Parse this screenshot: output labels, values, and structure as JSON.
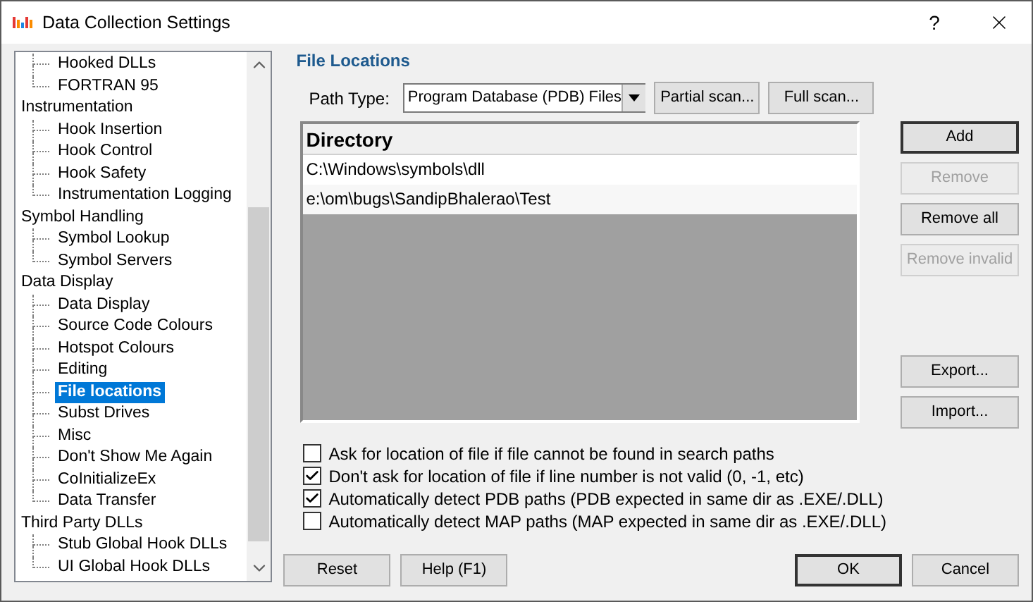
{
  "window": {
    "title": "Data Collection Settings",
    "help": "?"
  },
  "tree": [
    {
      "children": [
        {
          "label": "Hooked DLLs",
          "selected": false
        },
        {
          "label": "FORTRAN 95",
          "selected": false
        }
      ]
    },
    {
      "label": "Instrumentation",
      "selected": false,
      "children": [
        {
          "label": "Hook Insertion",
          "selected": false
        },
        {
          "label": "Hook Control",
          "selected": false
        },
        {
          "label": "Hook Safety",
          "selected": false
        },
        {
          "label": "Instrumentation Logging",
          "selected": false
        }
      ]
    },
    {
      "label": "Symbol Handling",
      "selected": false,
      "children": [
        {
          "label": "Symbol Lookup",
          "selected": false
        },
        {
          "label": "Symbol Servers",
          "selected": false
        }
      ]
    },
    {
      "label": "Data Display",
      "selected": false,
      "children": [
        {
          "label": "Data Display",
          "selected": false
        },
        {
          "label": "Source Code Colours",
          "selected": false
        },
        {
          "label": "Hotspot Colours",
          "selected": false
        },
        {
          "label": "Editing",
          "selected": false
        },
        {
          "label": "File locations",
          "selected": true
        },
        {
          "label": "Subst Drives",
          "selected": false
        },
        {
          "label": "Misc",
          "selected": false
        },
        {
          "label": "Don't Show Me Again",
          "selected": false
        },
        {
          "label": "CoInitializeEx",
          "selected": false
        },
        {
          "label": "Data Transfer",
          "selected": false
        }
      ]
    },
    {
      "label": "Third Party DLLs",
      "selected": false,
      "children": [
        {
          "label": "Stub Global Hook DLLs",
          "selected": false
        },
        {
          "label": "UI Global Hook DLLs",
          "selected": false
        }
      ]
    }
  ],
  "section_title": "File Locations",
  "path_type": {
    "label": "Path Type:",
    "value": "Program Database (PDB) Files"
  },
  "scan_buttons": [
    {
      "label": "Partial scan..."
    },
    {
      "label": "Full scan..."
    }
  ],
  "table": {
    "columns": [
      "Directory"
    ],
    "rows": [
      "C:\\Windows\\symbols\\dll",
      "e:\\om\\bugs\\SandipBhalerao\\Test"
    ]
  },
  "side_buttons": [
    {
      "label": "Add",
      "disabled": false,
      "default": true
    },
    {
      "label": "Remove",
      "disabled": true,
      "default": false
    },
    {
      "label": "Remove all",
      "disabled": false,
      "default": false
    },
    {
      "label": "Remove invalid",
      "disabled": true,
      "default": false
    }
  ],
  "io_buttons": [
    {
      "label": "Export...",
      "disabled": false
    },
    {
      "label": "Import...",
      "disabled": false
    }
  ],
  "options": [
    {
      "label": "Ask for location of file if file cannot be found in search paths",
      "checked": false
    },
    {
      "label": "Don't ask for location of file if line number is not valid (0, -1, etc)",
      "checked": true
    },
    {
      "label": "Automatically detect PDB paths (PDB expected in same dir as .EXE/.DLL)",
      "checked": true
    },
    {
      "label": "Automatically detect MAP paths (MAP expected in same dir as .EXE/.DLL)",
      "checked": false
    }
  ],
  "footer_left": [
    {
      "label": "Reset"
    },
    {
      "label": "Help (F1)"
    }
  ],
  "footer_right": [
    {
      "label": "OK",
      "default": true
    },
    {
      "label": "Cancel",
      "default": false
    }
  ]
}
